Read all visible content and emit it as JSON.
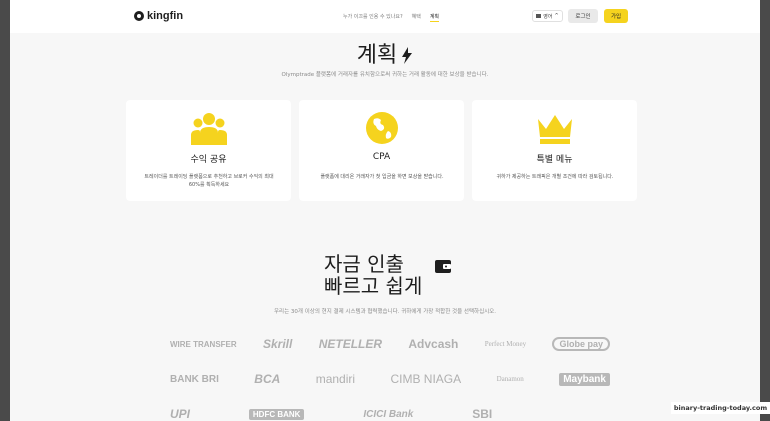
{
  "header": {
    "logo_text": "kingfin",
    "nav": [
      "누가 이끄를 인용 수 있나요?",
      "혜택",
      "계획"
    ],
    "lang_label": "영어",
    "login_label": "로그인",
    "signup_label": "가입"
  },
  "plans": {
    "title": "계획",
    "subtitle": "Olymptrade 플랫폼에 거래자를 유치함으로써 귀하는 거래 활동에 대한 보상을 받습니다.",
    "cards": [
      {
        "icon": "users-icon",
        "title": "수익 공유",
        "desc": "트레이더를 트레이딩 플랫폼으로 추천하고 브로커 수익의 최대 60%를 획득하세요"
      },
      {
        "icon": "globe-icon",
        "title": "CPA",
        "desc": "플랫폼에 대리온 거래자가 첫 입금을 하면 보상을 받습니다."
      },
      {
        "icon": "crown-icon",
        "title": "특별 메뉴",
        "desc": "귀하가 제공하는 트래픽은 개별 조건에 따라 검토됩니다."
      }
    ],
    "accent_color": "#f5d31e"
  },
  "withdraw": {
    "title_line1": "자금 인출",
    "title_line2": "빠르고 쉽게",
    "subtitle": "우리는 30개 이상의 현지 결제 시스템과 협력했습니다. 귀하에게 가장 적합한 것을 선택하십시오.",
    "payment_logos": [
      [
        "WIRE TRANSFER",
        "Skrill",
        "NETELLER",
        "Advcash",
        "Perfect Money",
        "Globe pay"
      ],
      [
        "BANK BRI",
        "BCA",
        "mandiri",
        "CIMB NIAGA",
        "Danamon",
        "Maybank"
      ],
      [
        "UPI",
        "HDFC BANK",
        "ICICI Bank",
        "SBI",
        "",
        ""
      ]
    ]
  },
  "watermark": "binary-trading-today.com"
}
